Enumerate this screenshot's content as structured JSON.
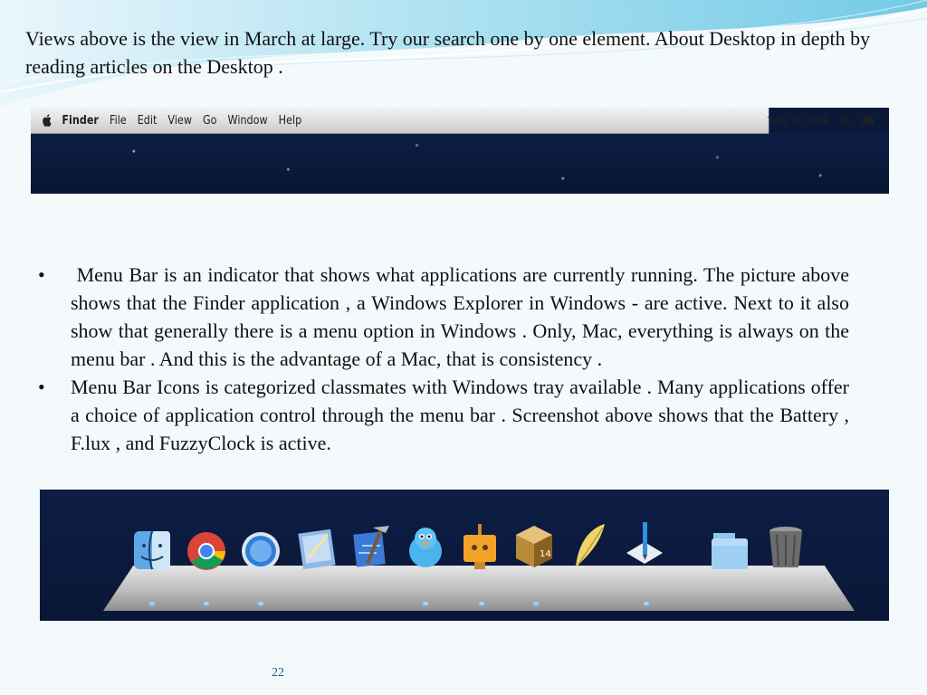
{
  "intro_text": "Views above is the view in March at large. Try our search one by one element. About Desktop in depth by reading articles on the Desktop .",
  "menubar": {
    "items": [
      "Finder",
      "File",
      "Edit",
      "View",
      "Go",
      "Window",
      "Help"
    ],
    "clock_text": "TEN TO ONE"
  },
  "bullets": [
    " Menu Bar is an indicator that shows what applications are currently running. The picture above shows that the Finder application , a Windows Explorer in Windows - are active. Next to it also show that generally there is a menu option in Windows . Only, Mac, everything is always on the menu bar . And this is the advantage of a Mac, that is consistency .",
    "Menu Bar Icons is categorized classmates with Windows tray available . Many applications offer a choice of application control through the menu bar . Screenshot above shows that the Battery , F.lux , and FuzzyClock is active."
  ],
  "bullet_marker": "•",
  "dock": {
    "icons": [
      "finder-icon",
      "chrome-icon",
      "safari-icon",
      "preview-icon",
      "xcode-icon",
      "twitterrific-icon",
      "stamp-icon",
      "cube-app-icon",
      "feather-icon",
      "pen-app-icon",
      "folder-icon",
      "trash-icon"
    ]
  },
  "page_number": "22",
  "colors": {
    "accent": "#1f5a8a",
    "dock_bg": "#0b1838",
    "wave": "#7fd3ea"
  }
}
